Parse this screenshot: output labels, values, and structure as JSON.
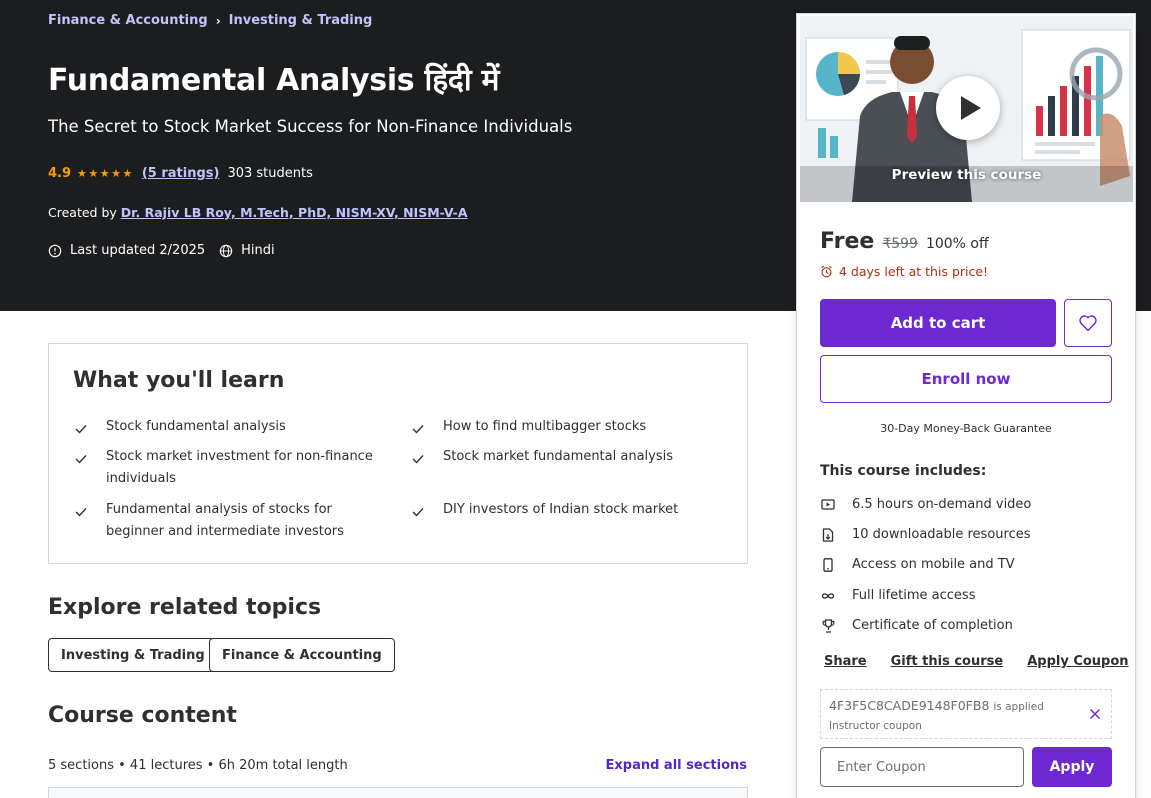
{
  "breadcrumb": {
    "items": [
      "Finance & Accounting",
      "Investing & Trading"
    ],
    "separator": "›"
  },
  "course": {
    "title": "Fundamental Analysis हिंदी में",
    "subtitle": "The Secret to Stock Market Success for Non-Finance Individuals",
    "rating": "4.9",
    "stars": "★★★★★",
    "ratings_link": "(5 ratings)",
    "students": "303 students",
    "created_by_label": "Created by",
    "instructor": "Dr. Rajiv LB Roy, M.Tech, PhD, NISM-XV, NISM-V-A",
    "last_updated": "Last updated 2/2025",
    "language": "Hindi"
  },
  "learn": {
    "title": "What you'll learn",
    "items": [
      "Stock fundamental analysis",
      "How to find multibagger stocks",
      "Stock market investment for non-finance individuals",
      "Stock market fundamental analysis",
      "Fundamental analysis of stocks for beginner and intermediate investors",
      "DIY investors of Indian stock market"
    ]
  },
  "explore": {
    "title": "Explore related topics",
    "topics": [
      "Investing & Trading",
      "Finance & Accounting"
    ]
  },
  "content": {
    "title": "Course content",
    "meta": "5 sections • 41 lectures • 6h 20m total length",
    "expand_label": "Expand all sections"
  },
  "card": {
    "preview_label": "Preview this course",
    "price": "Free",
    "original_price": "₹599",
    "discount": "100% off",
    "timer": "4 days left at this price!",
    "add_to_cart": "Add to cart",
    "enroll": "Enroll now",
    "guarantee": "30-Day Money-Back Guarantee",
    "includes_title": "This course includes:",
    "includes": [
      {
        "icon": "video-icon",
        "label": "6.5 hours on-demand video"
      },
      {
        "icon": "file-download-icon",
        "label": "10 downloadable resources"
      },
      {
        "icon": "mobile-icon",
        "label": "Access on mobile and TV"
      },
      {
        "icon": "infinity-icon",
        "label": "Full lifetime access"
      },
      {
        "icon": "trophy-icon",
        "label": "Certificate of completion"
      }
    ],
    "links": [
      "Share",
      "Gift this course",
      "Apply Coupon"
    ],
    "coupon_code": "4F3F5C8CADE9148F0FB8",
    "coupon_applied_text": "is applied",
    "coupon_type": "Instructor coupon",
    "coupon_placeholder": "Enter Coupon",
    "apply_label": "Apply"
  },
  "colors": {
    "hero_bg": "#1c1d1f",
    "accent": "#6d28d2",
    "link": "#c0c4fc",
    "star": "#f69c08",
    "timer": "#b32d0f"
  }
}
